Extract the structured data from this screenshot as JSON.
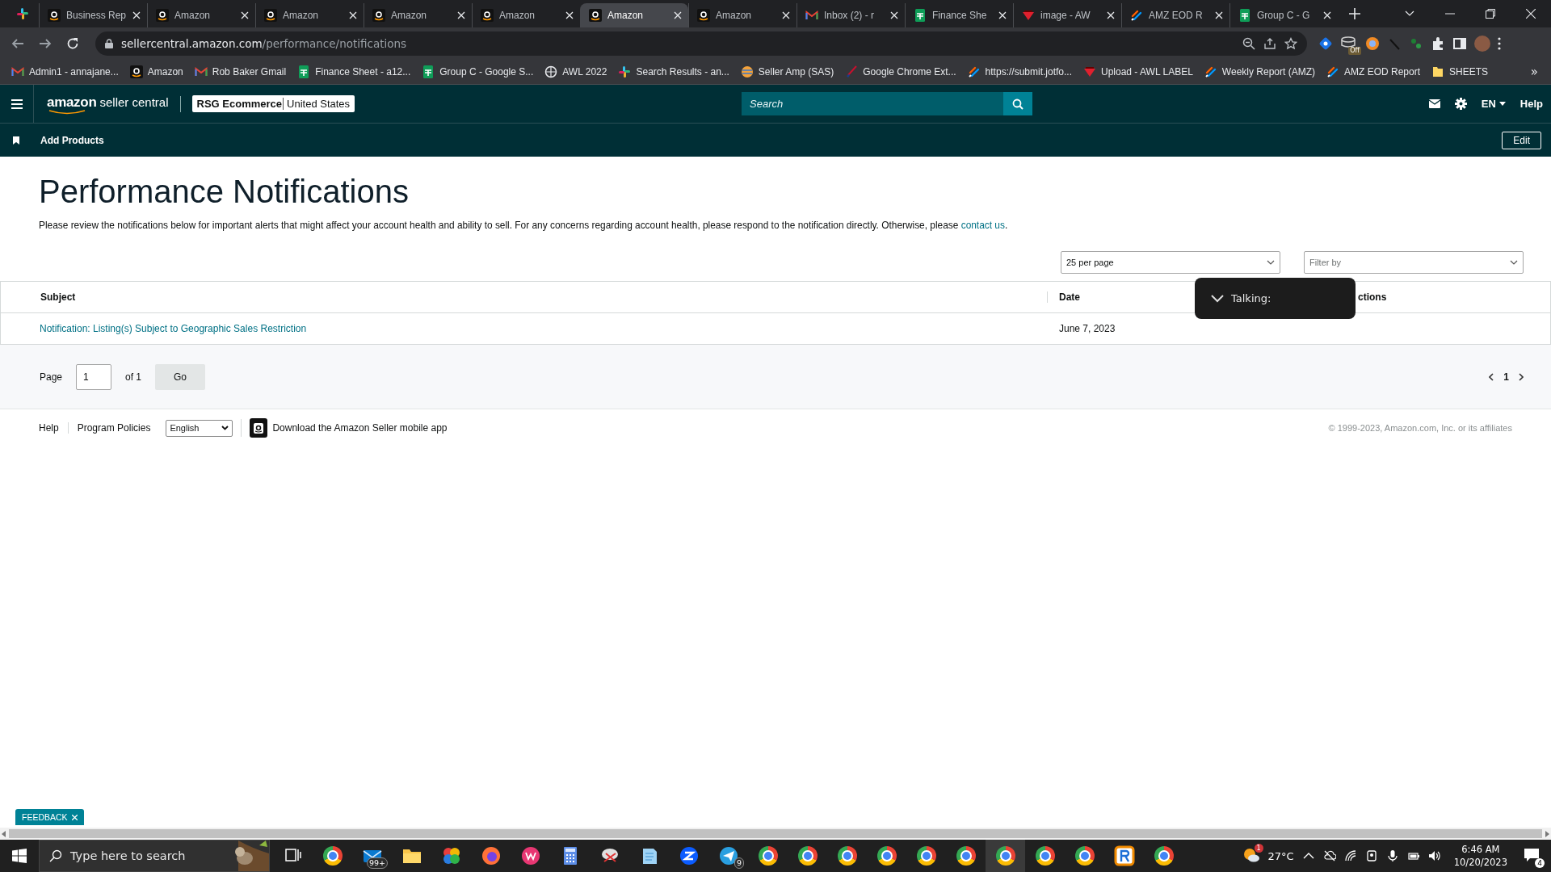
{
  "browser": {
    "tabs": [
      {
        "kind": "amazon",
        "title": "Business Rep",
        "selected": false
      },
      {
        "kind": "amazon",
        "title": "Amazon",
        "selected": false
      },
      {
        "kind": "amazon",
        "title": "Amazon",
        "selected": false
      },
      {
        "kind": "amazon",
        "title": "Amazon",
        "selected": false
      },
      {
        "kind": "amazon",
        "title": "Amazon",
        "selected": false
      },
      {
        "kind": "amazon",
        "title": "Amazon",
        "selected": true
      },
      {
        "kind": "amazon",
        "title": "Amazon",
        "selected": false
      },
      {
        "kind": "gmail",
        "title": "Inbox (2) - r",
        "selected": false
      },
      {
        "kind": "sheets",
        "title": "Finance She",
        "selected": false
      },
      {
        "kind": "awl",
        "title": "image - AW",
        "selected": false
      },
      {
        "kind": "jotform",
        "title": "AMZ EOD R",
        "selected": false
      },
      {
        "kind": "sheets",
        "title": "Group C - G",
        "selected": false
      }
    ],
    "url": {
      "host": "sellercentral.amazon.com",
      "path": "/performance/notifications"
    },
    "extension_badge": "Off",
    "bookmarks": [
      {
        "kind": "gmail",
        "title": "Admin1 - annajane..."
      },
      {
        "kind": "amazon",
        "title": "Amazon"
      },
      {
        "kind": "gmail",
        "title": "Rob Baker Gmail"
      },
      {
        "kind": "sheets",
        "title": "Finance Sheet - a12..."
      },
      {
        "kind": "sheets",
        "title": "Group C - Google S..."
      },
      {
        "kind": "globe",
        "title": "AWL 2022"
      },
      {
        "kind": "slack",
        "title": "Search Results - an..."
      },
      {
        "kind": "sas",
        "title": "Seller Amp (SAS)"
      },
      {
        "kind": "brush",
        "title": "Google Chrome Ext..."
      },
      {
        "kind": "jotform",
        "title": "https://submit.jotfo..."
      },
      {
        "kind": "awl",
        "title": "Upload - AWL LABEL"
      },
      {
        "kind": "jotform",
        "title": "Weekly Report (AMZ)"
      },
      {
        "kind": "jotform",
        "title": "AMZ EOD Report"
      },
      {
        "kind": "folder",
        "title": "SHEETS"
      }
    ],
    "bookmarks_more": "»"
  },
  "header": {
    "logo_brand": "amazon",
    "logo_product": "seller central",
    "store": "RSG Ecommerce",
    "region": "United States",
    "search_placeholder": "Search",
    "language": "EN",
    "help": "Help"
  },
  "nav": {
    "item": "Add Products",
    "edit": "Edit"
  },
  "page": {
    "title": "Performance Notifications",
    "description": "Please review the notifications below for important alerts that might affect your account health and ability to sell. For any concerns regarding account health, please respond to the notification directly. Otherwise, please",
    "description_link": "contact us",
    "description_end": ".",
    "per_page": "25 per page",
    "filter_placeholder": "Filter by",
    "columns": [
      "Subject",
      "Date",
      "ctions"
    ],
    "rows": [
      {
        "subject": "Notification: Listing(s) Subject to Geographic Sales Restriction",
        "date": "June 7, 2023"
      }
    ],
    "pagination": {
      "label": "Page",
      "value": "1",
      "of": "of 1",
      "go": "Go",
      "current": "1"
    },
    "overlay": "Talking:"
  },
  "footer": {
    "links": [
      "Help",
      "Program Policies"
    ],
    "language": "English",
    "app": "Download the Amazon Seller mobile app",
    "copyright": "© 1999-2023, Amazon.com, Inc. or its affiliates"
  },
  "feedback": "FEEDBACK",
  "taskbar": {
    "search_placeholder": "Type here to search",
    "apps": [
      {
        "kind": "taskview",
        "selected": false
      },
      {
        "kind": "chrome",
        "selected": false
      },
      {
        "kind": "mail",
        "selected": false,
        "badge": "99+"
      },
      {
        "kind": "folder",
        "selected": false
      },
      {
        "kind": "photos",
        "selected": false
      },
      {
        "kind": "firefox",
        "selected": false
      },
      {
        "kind": "wps",
        "selected": false
      },
      {
        "kind": "calculator",
        "selected": false
      },
      {
        "kind": "snip",
        "selected": false
      },
      {
        "kind": "notepad",
        "selected": false
      },
      {
        "kind": "zoom",
        "selected": false
      },
      {
        "kind": "telegram",
        "selected": false,
        "badge": "9"
      },
      {
        "kind": "chrome",
        "selected": false
      },
      {
        "kind": "chrome",
        "selected": false
      },
      {
        "kind": "chrome",
        "selected": false
      },
      {
        "kind": "chrome",
        "selected": false
      },
      {
        "kind": "chrome",
        "selected": false
      },
      {
        "kind": "chrome",
        "selected": false
      },
      {
        "kind": "chrome",
        "selected": true
      },
      {
        "kind": "chrome",
        "selected": false
      },
      {
        "kind": "chrome",
        "selected": false
      },
      {
        "kind": "rapid",
        "selected": false
      },
      {
        "kind": "chrome",
        "selected": false
      }
    ],
    "weather_badge": "1",
    "temperature": "27°C",
    "time": "6:46 AM",
    "date": "10/20/2023",
    "notifications": "4"
  }
}
